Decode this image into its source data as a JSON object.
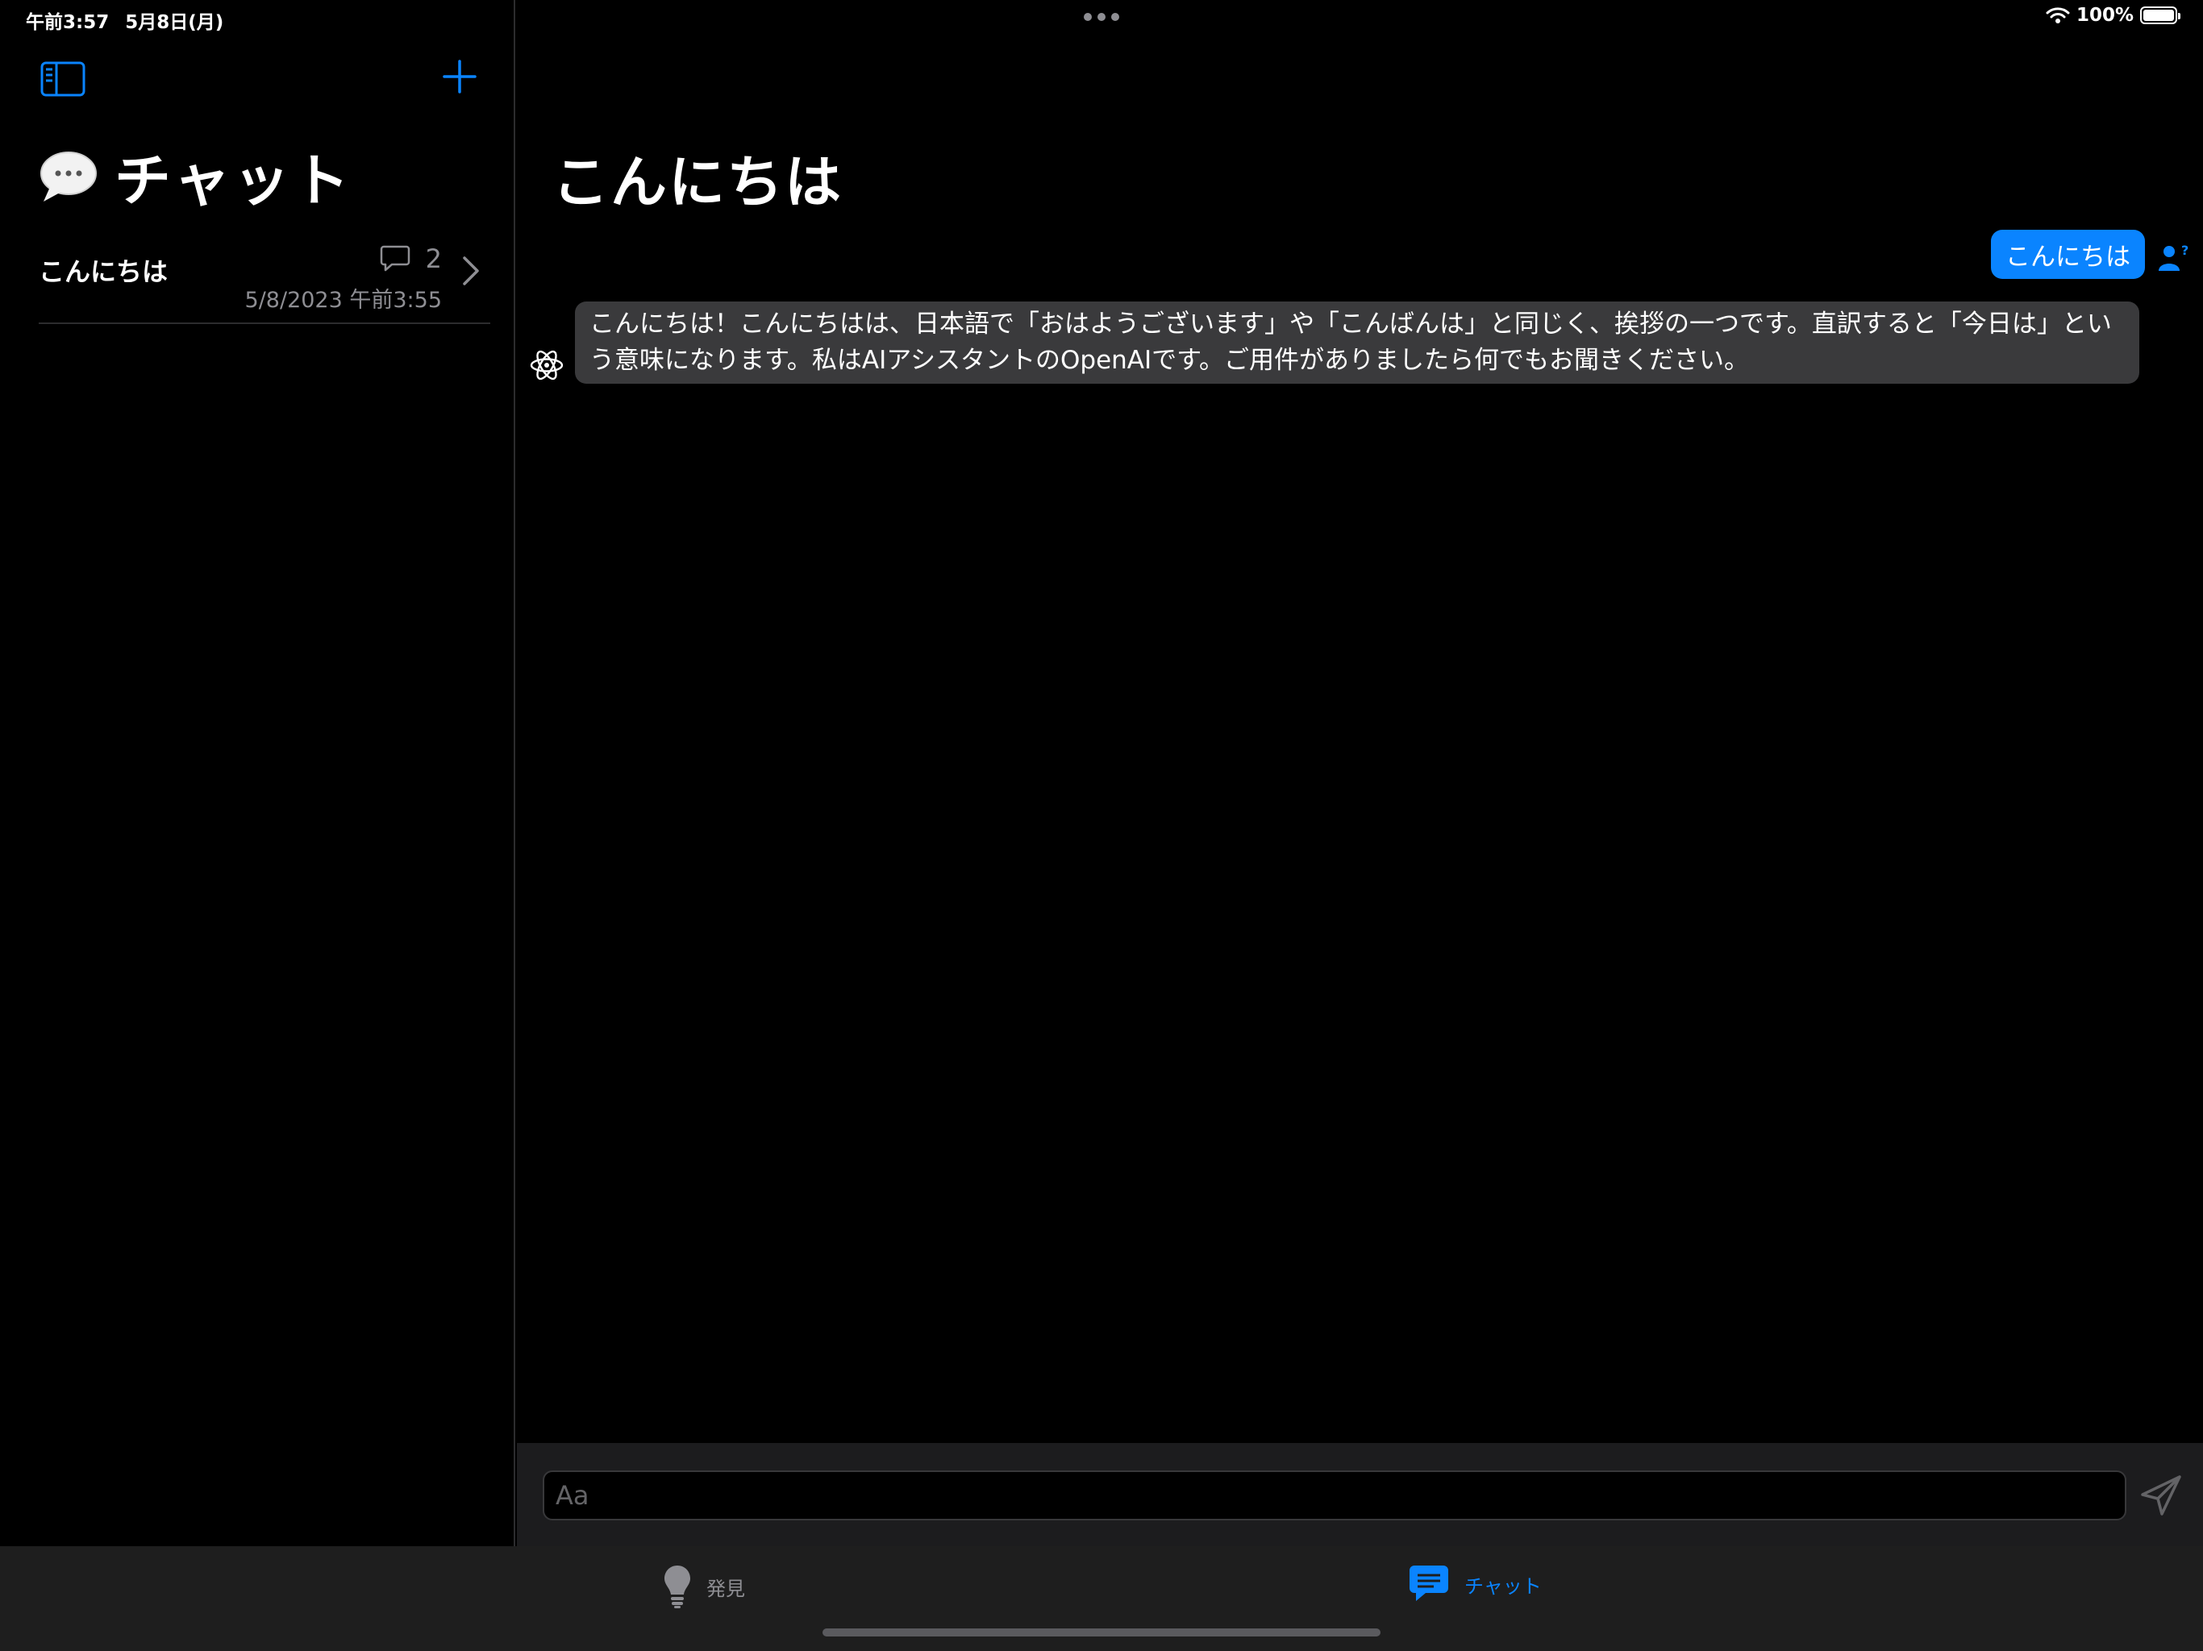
{
  "status_bar": {
    "time": "午前3:57",
    "date": "5月8日(月)",
    "battery": "100%",
    "battery_level": 1.0
  },
  "sidebar": {
    "title": "チャット",
    "chats": [
      {
        "title": "こんにちは",
        "message_count": "2",
        "date": "5/8/2023 午前3:55"
      }
    ]
  },
  "conversation": {
    "title": "こんにちは",
    "messages": [
      {
        "role": "user",
        "text": "こんにちは"
      },
      {
        "role": "assistant",
        "text": "こんにちは！こんにちはは、日本語で「おはようございます」や「こんばんは」と同じく、挨拶の一つです。直訳すると「今日は」という意味になります。私はAIアシスタントのOpenAIです。ご用件がありましたら何でもお聞きください。"
      }
    ]
  },
  "input": {
    "placeholder": "Aa",
    "value": ""
  },
  "tab_bar": {
    "tabs": [
      {
        "label": "発見",
        "icon": "lightbulb-icon",
        "selected": false
      },
      {
        "label": "チャット",
        "icon": "chat-bubble-icon",
        "selected": true
      }
    ]
  },
  "colors": {
    "accent": "#0a84ff",
    "background": "#000000",
    "assistant_bubble": "#3a3a3c",
    "secondary_text": "#8e8e93"
  }
}
